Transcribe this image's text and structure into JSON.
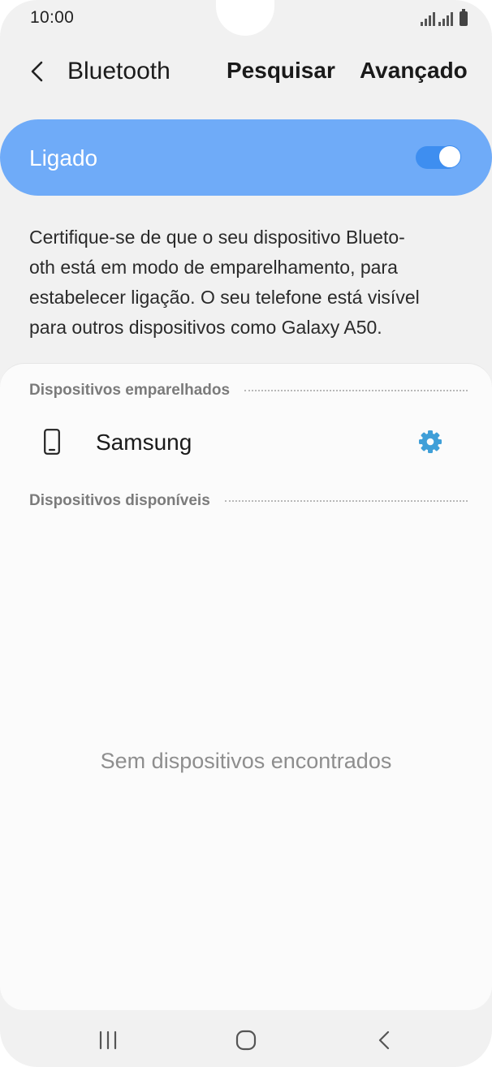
{
  "status_bar": {
    "time": "10:00",
    "icons": [
      "signal-icon",
      "signal-icon",
      "battery-icon"
    ]
  },
  "header": {
    "back_icon": "chevron-left-icon",
    "title": "Bluetooth",
    "actions": [
      "Pesquisar",
      "Avançado"
    ]
  },
  "master_switch": {
    "label": "Ligado",
    "checked": true,
    "card_color": "#6fabf8",
    "toggle_color": "#3e8ef0"
  },
  "description": {
    "lines": [
      "Certifique-se de que o seu dispositivo Blueto-",
      "oth está em modo de emparelhamento, para",
      "estabelecer ligação. O seu telefone está visível",
      "para outros dispositivos como Galaxy A50."
    ]
  },
  "paired_devices": {
    "title": "Dispositivos emparelhados",
    "items": [
      {
        "name": "Samsung",
        "icon": "smartphone-icon",
        "action_icon": "gear-icon",
        "action_color": "#3f9fd8"
      }
    ]
  },
  "available_devices": {
    "title": "Dispositivos disponíveis",
    "empty_message": "Sem dispositivos encontrados"
  },
  "nav_bar": {
    "buttons": [
      "recents-icon",
      "home-icon",
      "back-icon"
    ]
  }
}
